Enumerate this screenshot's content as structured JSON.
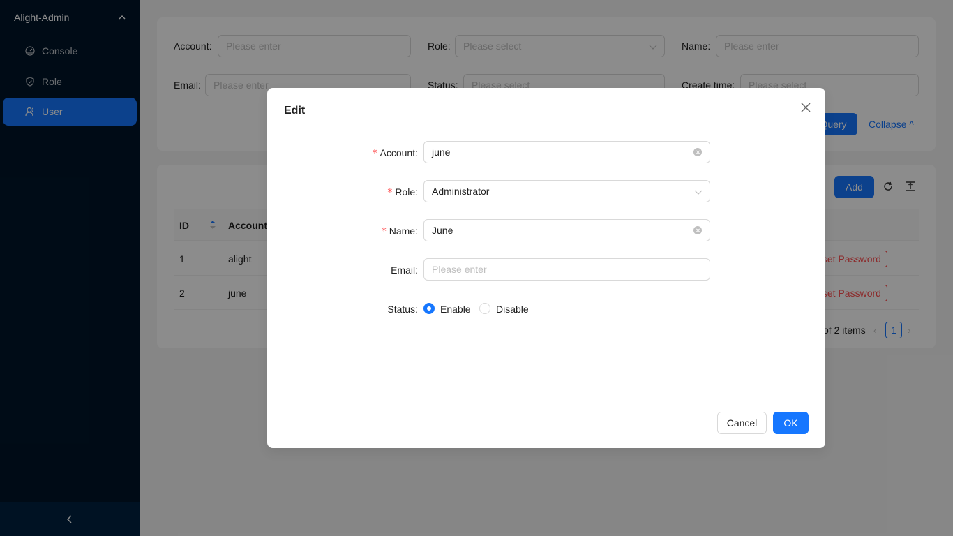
{
  "app": {
    "title": "Alight-Admin"
  },
  "sidebar": {
    "items": [
      {
        "label": "Console",
        "icon": "dashboard-icon"
      },
      {
        "label": "Role",
        "icon": "shield-icon"
      },
      {
        "label": "User",
        "icon": "user-icon"
      }
    ]
  },
  "search": {
    "account_label": "Account",
    "account_placeholder": "Please enter",
    "role_label": "Role",
    "role_placeholder": "Please select",
    "name_label": "Name",
    "name_placeholder": "Please enter",
    "email_label": "Email",
    "email_placeholder": "Please enter",
    "status_label": "Status",
    "status_placeholder": "Please select",
    "create_time_label": "Create time",
    "start_placeholder": "Please select",
    "end_placeholder": "Please select",
    "query_label": "Query",
    "collapse_label": "Collapse"
  },
  "toolbar": {
    "add_label": "Add"
  },
  "table": {
    "columns": [
      "ID",
      "Account"
    ],
    "rows": [
      {
        "id": "1",
        "account": "alight",
        "action": "Reset Password"
      },
      {
        "id": "2",
        "account": "june",
        "action": "Reset Password"
      }
    ]
  },
  "pagination": {
    "total_text": "of 2 items",
    "current_page": "1"
  },
  "modal": {
    "title": "Edit",
    "account_label": "Account",
    "account_value": "june",
    "role_label": "Role",
    "role_value": "Administrator",
    "name_label": "Name",
    "name_value": "June",
    "email_label": "Email",
    "email_placeholder": "Please enter",
    "status_label": "Status",
    "status_options": [
      "Enable",
      "Disable"
    ],
    "status_selected": "Enable",
    "cancel_label": "Cancel",
    "ok_label": "OK"
  },
  "colors": {
    "primary": "#1677ff",
    "danger": "#ff4d4f",
    "sidebar_bg": "#001529"
  }
}
